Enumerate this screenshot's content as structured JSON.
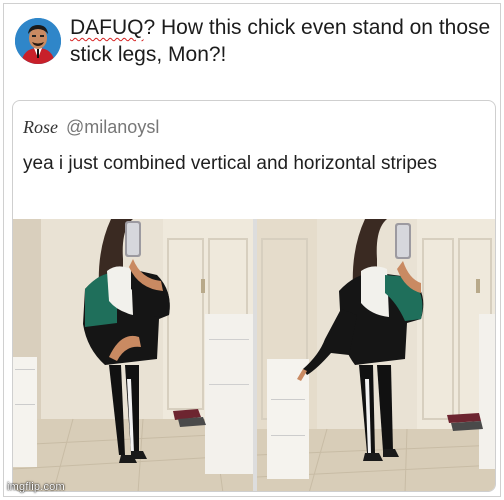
{
  "post": {
    "text_lead": "DAFUQ",
    "text_rest": "? How this chick even stand on those stick legs, Mon?!"
  },
  "tweet": {
    "display_name": "Rose",
    "handle": "@milanoysl",
    "text": "yea i just combined vertical and horizontal stripes"
  },
  "watermark": "imgflip.com",
  "icons": {
    "avatar": "avatar-man-red-suit",
    "photo_left": "mirror-selfie-photo",
    "photo_right": "mirror-selfie-photo"
  },
  "colors": {
    "sweater_green": "#1f6f5b",
    "sweater_white": "#f2f1ec",
    "sweater_black": "#151515",
    "misspell_underline": "#d62020",
    "avatar_bg": "#2f86c9"
  }
}
